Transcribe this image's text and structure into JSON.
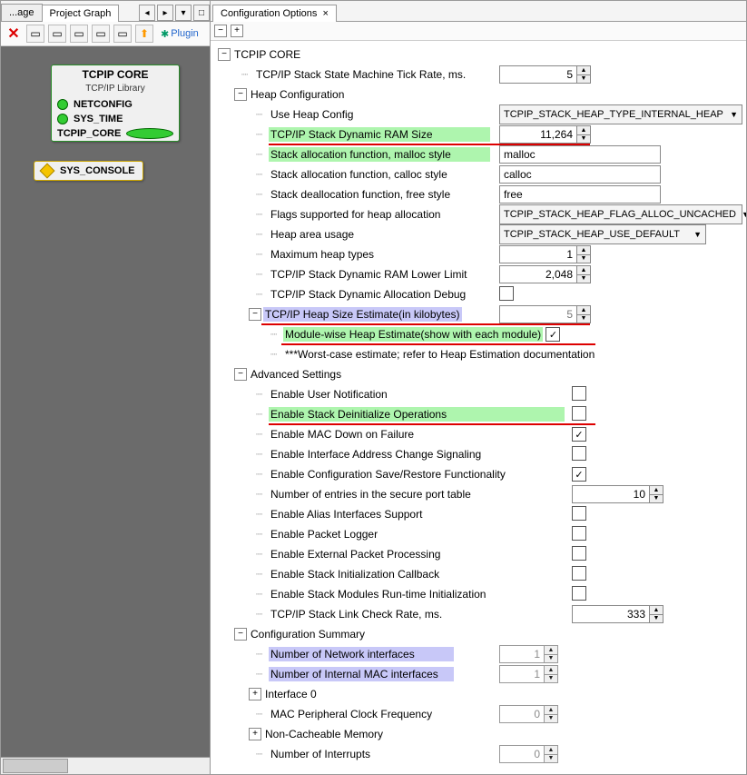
{
  "left": {
    "tabs": {
      "truncated": "...age",
      "active": "Project Graph"
    },
    "plugins_label": "Plugin",
    "node_title": "TCPIP CORE",
    "node_sub": "TCP/IP Library",
    "rows": [
      "NETCONFIG",
      "SYS_TIME",
      "TCPIP_CORE"
    ],
    "node2": "SYS_CONSOLE"
  },
  "right": {
    "tab": "Configuration Options",
    "tcpip_core": "TCPIP CORE",
    "tick_rate_label": "TCP/IP Stack State Machine Tick Rate, ms.",
    "tick_rate_value": "5",
    "heap_config": "Heap Configuration",
    "use_heap_config": "Use Heap Config",
    "use_heap_config_value": "TCPIP_STACK_HEAP_TYPE_INTERNAL_HEAP",
    "dyn_ram_size": "TCP/IP Stack Dynamic RAM Size",
    "dyn_ram_size_value": "11,264",
    "malloc_label": "Stack allocation function, malloc style",
    "malloc_value": "malloc",
    "calloc_label": "Stack allocation function, calloc style",
    "calloc_value": "calloc",
    "free_label": "Stack deallocation function, free style",
    "free_value": "free",
    "flags_label": "Flags supported for heap allocation",
    "flags_value": "TCPIP_STACK_HEAP_FLAG_ALLOC_UNCACHED",
    "heap_area_label": "Heap area usage",
    "heap_area_value": "TCPIP_STACK_HEAP_USE_DEFAULT",
    "max_heap_types": "Maximum heap types",
    "max_heap_types_value": "1",
    "ram_lower_limit": "TCP/IP Stack Dynamic RAM Lower Limit",
    "ram_lower_limit_value": "2,048",
    "dyn_alloc_debug": "TCP/IP Stack Dynamic Allocation Debug",
    "heap_size_est": "TCP/IP Heap Size Estimate(in kilobytes)",
    "heap_size_est_value": "5",
    "module_wise": "Module-wise Heap Estimate(show with each module)",
    "worst_case": "***Worst-case estimate; refer to Heap Estimation documentation",
    "adv_settings": "Advanced Settings",
    "adv": [
      "Enable User Notification",
      "Enable Stack Deinitialize Operations",
      "Enable MAC Down on Failure",
      "Enable Interface Address Change Signaling",
      "Enable Configuration Save/Restore Functionality",
      "Number of entries in the secure port table",
      "Enable Alias Interfaces Support",
      "Enable Packet Logger",
      "Enable External Packet Processing",
      "Enable Stack Initialization Callback",
      "Enable Stack Modules Run-time Initialization",
      "TCP/IP Stack Link Check Rate, ms."
    ],
    "secure_port_value": "10",
    "link_check_value": "333",
    "config_summary": "Configuration Summary",
    "num_net_if": "Number of Network interfaces",
    "num_net_if_value": "1",
    "num_mac_if": "Number of Internal MAC interfaces",
    "num_mac_if_value": "1",
    "interface0": "Interface 0",
    "mac_clock": "MAC Peripheral Clock Frequency",
    "mac_clock_value": "0",
    "non_cache": "Non-Cacheable Memory",
    "num_int": "Number of Interrupts",
    "num_int_value": "0"
  }
}
